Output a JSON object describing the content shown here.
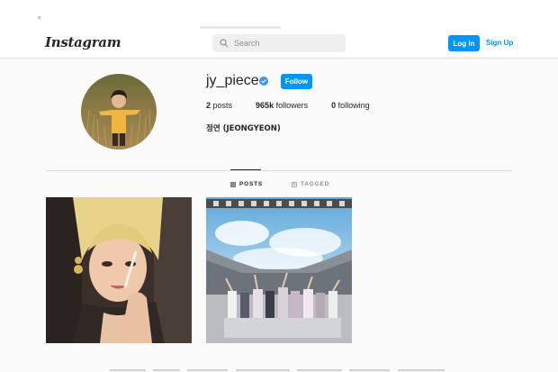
{
  "header": {
    "logo": "Instagram",
    "search_placeholder": "Search",
    "login_label": "Log In",
    "signup_label": "Sign Up"
  },
  "profile": {
    "username": "jy_piece",
    "verified_icon": "verified-badge-icon",
    "follow_label": "Follow",
    "posts_count": "2",
    "posts_label": "posts",
    "followers_count": "965k",
    "followers_label": "followers",
    "following_count": "0",
    "following_label": "following",
    "full_name": "정연 (JEONGYEON)"
  },
  "tabs": [
    {
      "label": "POSTS",
      "icon": "grid-icon",
      "active": true
    },
    {
      "label": "TAGGED",
      "icon": "tag-icon",
      "active": false
    }
  ],
  "posts": [
    {
      "description_icon": "photo-selfie"
    },
    {
      "description_icon": "photo-stadium"
    }
  ],
  "colors": {
    "accent": "#0095f6",
    "text": "#262626",
    "muted": "#8e8e8e",
    "background": "#fafafa"
  }
}
